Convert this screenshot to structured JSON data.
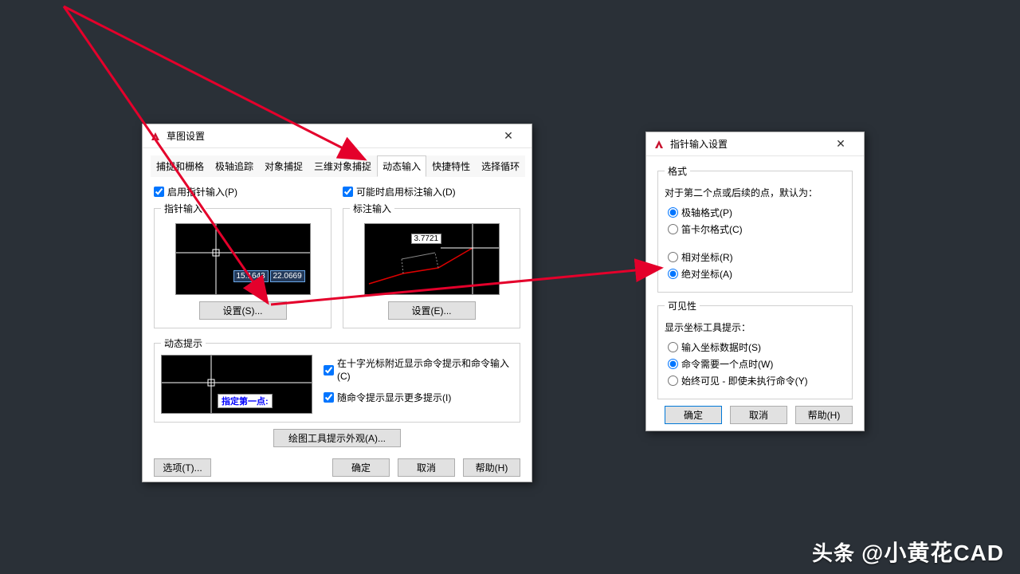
{
  "dialog1": {
    "title": "草图设置",
    "tabs": [
      "捕捉和栅格",
      "极轴追踪",
      "对象捕捉",
      "三维对象捕捉",
      "动态输入",
      "快捷特性",
      "选择循环"
    ],
    "active_tab_index": 4,
    "pointer_enable": "启用指针输入(P)",
    "dim_enable": "可能时启用标注输入(D)",
    "group_pointer": "指针输入",
    "group_dim": "标注输入",
    "group_dyn": "动态提示",
    "coord_x": "15.1643",
    "coord_y": "22.0669",
    "dim_val": "3.7721",
    "prompt_text": "指定第一点:",
    "dyn_opt1": "在十字光标附近显示命令提示和命令输入(C)",
    "dyn_opt2": "随命令提示显示更多提示(I)",
    "settings_btn": "设置(S)...",
    "settings_btn2": "设置(E)...",
    "appearance_btn": "绘图工具提示外观(A)...",
    "options_btn": "选项(T)...",
    "ok": "确定",
    "cancel": "取消",
    "help": "帮助(H)"
  },
  "dialog2": {
    "title": "指针输入设置",
    "format_group": "格式",
    "format_desc": "对于第二个点或后续的点，默认为：",
    "fmt_polar": "极轴格式(P)",
    "fmt_cartesian": "笛卡尔格式(C)",
    "fmt_relative": "相对坐标(R)",
    "fmt_absolute": "绝对坐标(A)",
    "vis_group": "可见性",
    "vis_desc": "显示坐标工具提示：",
    "vis_opt1": "输入坐标数据时(S)",
    "vis_opt2": "命令需要一个点时(W)",
    "vis_opt3": "始终可见 - 即使未执行命令(Y)",
    "ok": "确定",
    "cancel": "取消",
    "help": "帮助(H)"
  },
  "watermark": {
    "prefix": "头条",
    "author": "@小黄花CAD"
  }
}
